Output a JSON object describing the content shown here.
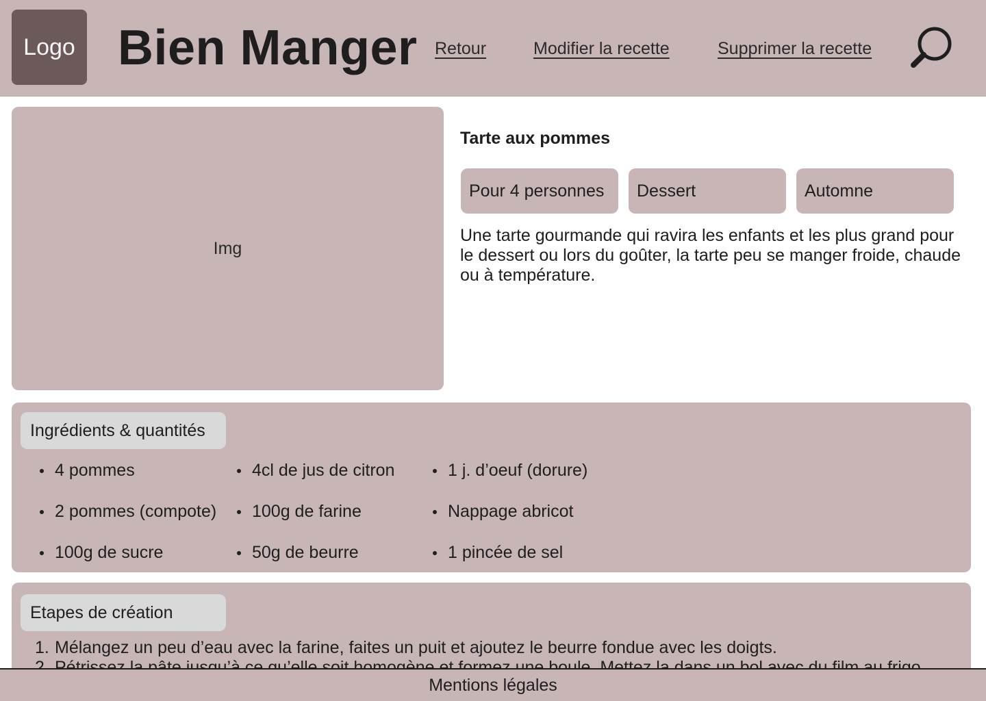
{
  "header": {
    "logo_label": "Logo",
    "site_title": "Bien Manger",
    "nav": {
      "back": "Retour",
      "edit": "Modifier la recette",
      "delete": "Supprimer la recette"
    },
    "search_icon": "search-icon"
  },
  "recipe": {
    "image_placeholder": "Img",
    "title": "Tarte aux pommes",
    "tags": [
      "Pour 4 personnes",
      "Dessert",
      "Automne"
    ],
    "description": "Une tarte gourmande qui ravira les enfants et les plus grand pour le dessert ou lors du goûter, la tarte peu se manger froide, chaude ou à température."
  },
  "ingredients": {
    "label": "Ingrédients & quantités",
    "columns": [
      [
        "4 pommes",
        "2 pommes (compote)",
        "100g de sucre"
      ],
      [
        "4cl de jus de citron",
        "100g de farine",
        "50g de beurre"
      ],
      [
        "1 j. d’oeuf (dorure)",
        "Nappage abricot",
        "1 pincée de sel"
      ]
    ]
  },
  "steps": {
    "label": "Etapes de création",
    "items": [
      {
        "number": "1.",
        "text": "Mélangez un peu d’eau avec la farine, faites un puit et ajoutez le beurre fondue avec les doigts."
      },
      {
        "number": "2.",
        "text": "Pétrissez la pâte jusqu’à ce qu’elle soit homogène et formez une boule. Mettez la dans un bol avec du film au frigo."
      }
    ]
  },
  "footer": {
    "legal": "Mentions légales"
  },
  "colors": {
    "panel": "#c8b6b6",
    "logo_bg": "#6c5959",
    "label_bg": "#d9d9d9",
    "text": "#1e1e1e"
  }
}
